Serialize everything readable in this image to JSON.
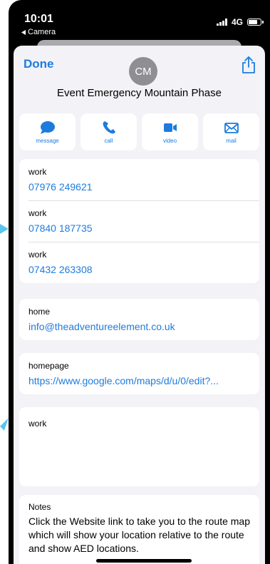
{
  "status_bar": {
    "time": "10:01",
    "back_app": "Camera",
    "network": "4G"
  },
  "header": {
    "done_label": "Done",
    "avatar_initials": "CM",
    "contact_name": "Event Emergency Mountain Phase"
  },
  "actions": [
    {
      "label": "message",
      "icon": "message-icon"
    },
    {
      "label": "call",
      "icon": "phone-icon"
    },
    {
      "label": "video",
      "icon": "video-icon"
    },
    {
      "label": "mail",
      "icon": "mail-icon"
    }
  ],
  "phones": [
    {
      "label": "work",
      "value": "07976 249621"
    },
    {
      "label": "work",
      "value": "07840 187735"
    },
    {
      "label": "work",
      "value": "07432 263308"
    }
  ],
  "email": {
    "label": "home",
    "value": "info@theadventureelement.co.uk"
  },
  "url": {
    "label": "homepage",
    "value": "https://www.google.com/maps/d/u/0/edit?..."
  },
  "address": {
    "label": "work"
  },
  "notes": {
    "label": "Notes",
    "text": "Click the Website link to take you to the route map which will show your location relative to the route and show AED locations."
  },
  "colors": {
    "accent": "#1d7bde",
    "sheet_background": "#f2f2f7",
    "decor_arrow": "#5bc3ec"
  }
}
